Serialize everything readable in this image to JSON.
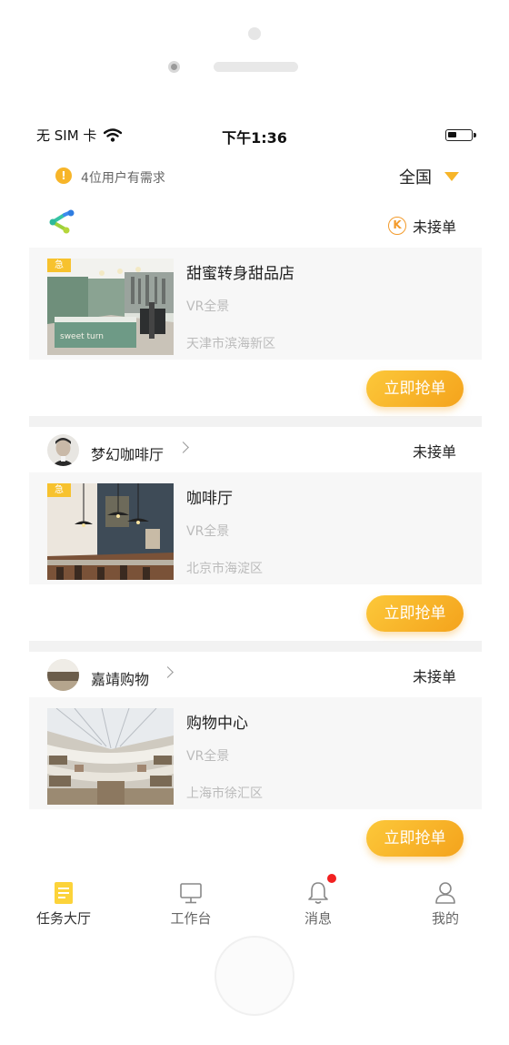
{
  "status_bar": {
    "carrier": "无 SIM 卡",
    "time": "下午1:36"
  },
  "notice": {
    "icon": "!",
    "text": "4位用户有需求",
    "region": "全国"
  },
  "tasks": [
    {
      "shop_name": "",
      "status_icon": "K",
      "status": "未接单",
      "badge": "急",
      "title": "甜蜜转身甜品店",
      "type": "VR全景",
      "location": "天津市滨海新区",
      "button": "立即抢单"
    },
    {
      "shop_name": "梦幻咖啡厅",
      "status": "未接单",
      "badge": "急",
      "title": "咖啡厅",
      "type": "VR全景",
      "location": "北京市海淀区",
      "button": "立即抢单"
    },
    {
      "shop_name": "嘉靖购物",
      "status": "未接单",
      "badge": "",
      "title": "购物中心",
      "type": "VR全景",
      "location": "上海市徐汇区",
      "button": "立即抢单"
    }
  ],
  "tab_bar": {
    "items": [
      {
        "label": "任务大厅",
        "icon": "task-hall-icon"
      },
      {
        "label": "工作台",
        "icon": "monitor-icon"
      },
      {
        "label": "消息",
        "icon": "bell-icon"
      },
      {
        "label": "我的",
        "icon": "profile-icon"
      }
    ]
  },
  "colors": {
    "accent": "#f7b529",
    "badge_red": "#f22020"
  }
}
